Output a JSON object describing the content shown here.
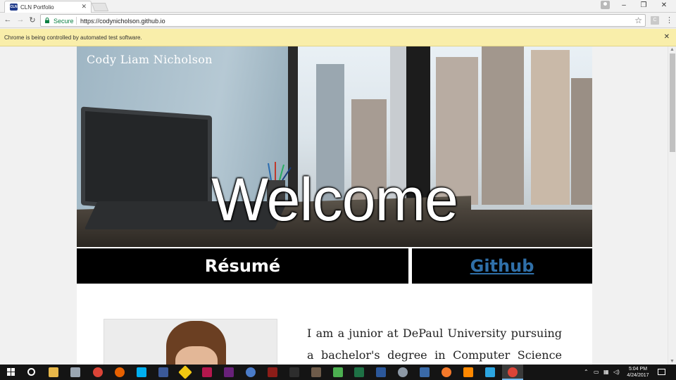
{
  "browser": {
    "tab_title": "CLN Portfolio",
    "tab_favicon_text": "CLN",
    "tab_close": "✕",
    "secure_label": "Secure",
    "url": "https://codynicholson.github.io",
    "infobar_text": "Chrome is being controlled by automated test software.",
    "infobar_close": "✕",
    "minimize": "–",
    "restore": "❐",
    "close": "✕",
    "back": "←",
    "forward": "→",
    "reload": "↻",
    "star": "☆",
    "extension_letter": "C",
    "menu": "⋮"
  },
  "hero": {
    "name": "Cody Liam Nicholson",
    "welcome": "Welcome"
  },
  "nav": {
    "resume": "Résumé",
    "github": "Github"
  },
  "content": {
    "bio": "I am a junior at DePaul University pursuing a bachelor's degree in Computer Science and a"
  },
  "taskbar": {
    "time": "5:04 PM",
    "date": "4/24/2017",
    "active_color": "#76b9ed"
  }
}
